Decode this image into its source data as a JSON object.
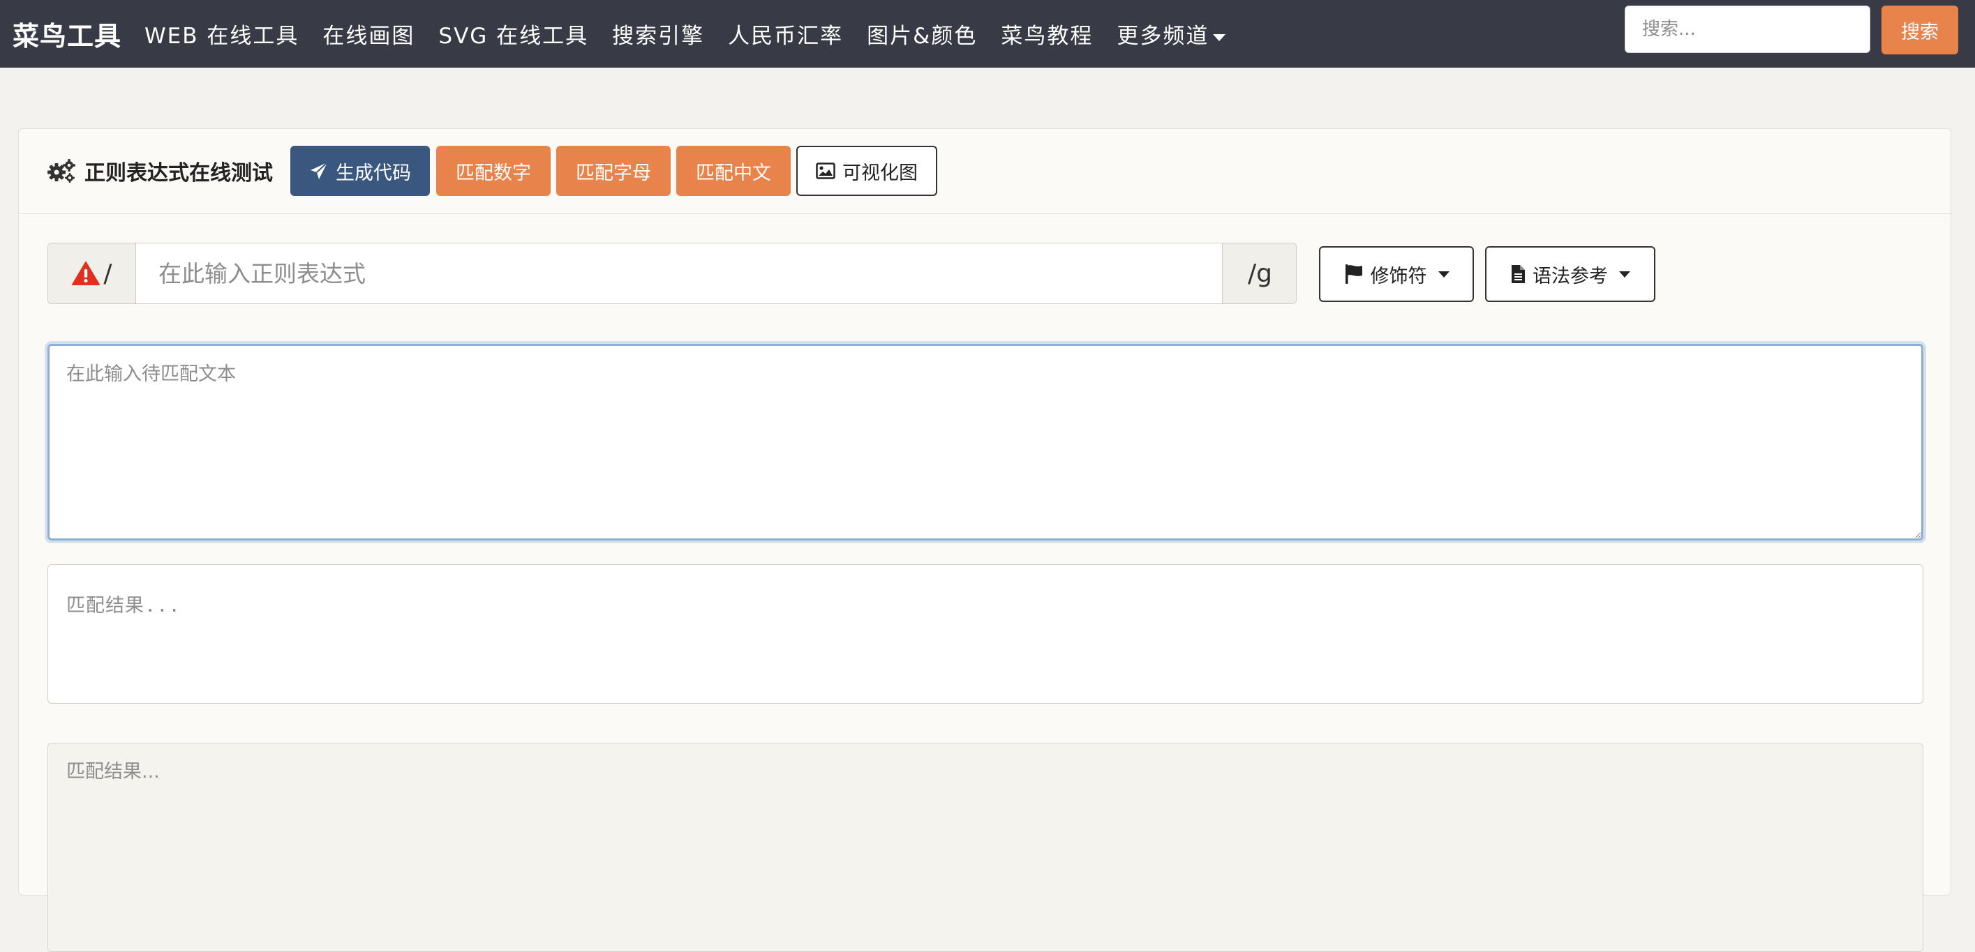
{
  "navbar": {
    "brand": "菜鸟工具",
    "links": [
      {
        "label": "WEB 在线工具"
      },
      {
        "label": "在线画图"
      },
      {
        "label": "SVG 在线工具"
      },
      {
        "label": "搜索引擎"
      },
      {
        "label": "人民币汇率"
      },
      {
        "label": "图片&颜色"
      },
      {
        "label": "菜鸟教程"
      },
      {
        "label": "更多频道"
      }
    ],
    "search_placeholder": "搜索...",
    "search_button": "搜索"
  },
  "card": {
    "title": "正则表达式在线测试",
    "buttons": {
      "generate_code": "生成代码",
      "match_digits": "匹配数字",
      "match_letters": "匹配字母",
      "match_chinese": "匹配中文",
      "visualize": "可视化图"
    }
  },
  "regex": {
    "prefix": "/",
    "placeholder": "在此输入正则表达式",
    "suffix": "/g",
    "modifiers_button": "修饰符",
    "syntax_button": "语法参考"
  },
  "text_input": {
    "placeholder": "在此输入待匹配文本"
  },
  "result_primary": "匹配结果...",
  "result_secondary_placeholder": "匹配结果..."
}
